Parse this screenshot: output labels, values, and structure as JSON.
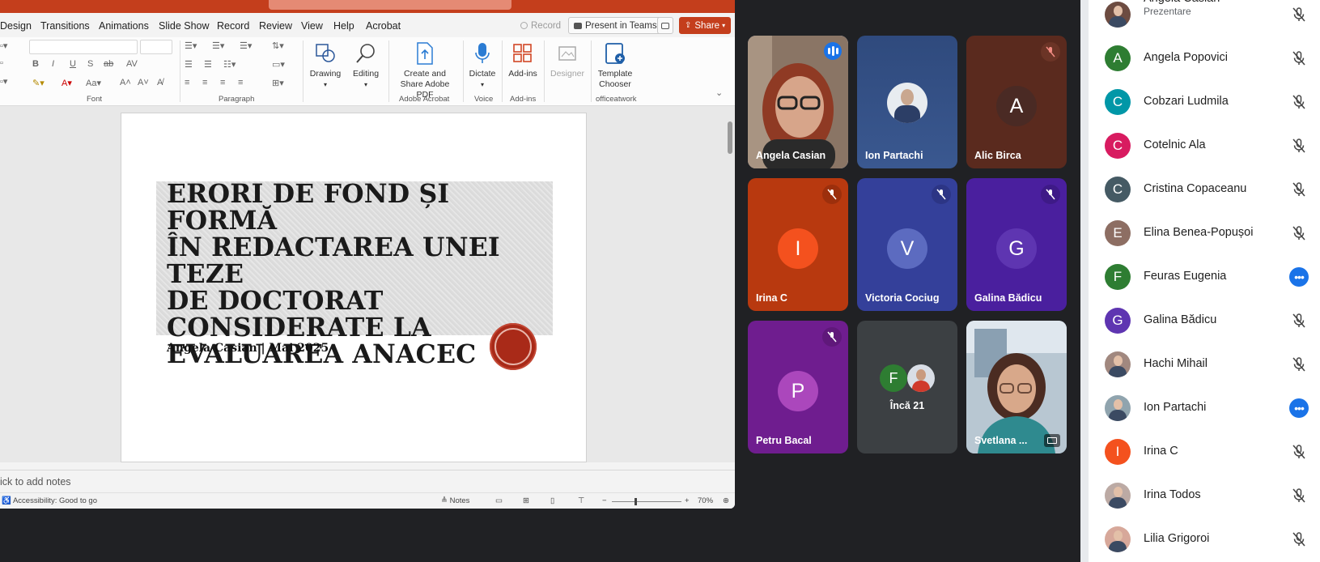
{
  "ppt": {
    "menu_tabs": [
      "Design",
      "Transitions",
      "Animations",
      "Slide Show",
      "Record",
      "Review",
      "View",
      "Help",
      "Acrobat"
    ],
    "record_label": "Record",
    "present_teams_label": "Present in Teams",
    "share_label": "Share",
    "ribbon": {
      "font_group": "Font",
      "paragraph_group": "Paragraph",
      "drawing": "Drawing",
      "editing": "Editing",
      "create_share": "Create and Share Adobe PDF",
      "adobe_group": "Adobe Acrobat",
      "dictate": "Dictate",
      "voice_group": "Voice",
      "addins": "Add-ins",
      "addins_group": "Add-ins",
      "designer": "Designer",
      "template_chooser": "Template Chooser",
      "officeatwork_group": "officeatwork"
    },
    "slide": {
      "title_lines": [
        "ERORI DE FOND ȘI FORMĂ",
        "ÎN REDACTAREA UNEI TEZE",
        "DE DOCTORAT",
        "CONSIDERATE LA",
        "EVALUAREA ANACEC"
      ],
      "subtitle": "Angela Casian | Mai 2025"
    },
    "notes_placeholder": "ick to add notes",
    "status": {
      "accessibility": "Accessibility: Good to go",
      "notes_btn": "Notes",
      "zoom": "70%"
    }
  },
  "meet": {
    "tiles": [
      {
        "name": "Angela Casian",
        "type": "video",
        "speaking": true,
        "muted": false
      },
      {
        "name": "Ion Partachi",
        "type": "photo",
        "muted": false
      },
      {
        "name": "Alic Birca",
        "letter": "A",
        "bg": "#5a2a1e",
        "avatar": "#4a2a24",
        "muted": true
      },
      {
        "name": "Irina C",
        "letter": "I",
        "bg": "#b8390f",
        "avatar": "#f4511e",
        "muted": true
      },
      {
        "name": "Victoria Cociug",
        "letter": "V",
        "bg": "#34409a",
        "avatar": "#5c6bc0",
        "muted": true
      },
      {
        "name": "Galina Bădicu",
        "letter": "G",
        "bg": "#4a1f9e",
        "avatar": "#5e35b1",
        "muted": true
      },
      {
        "name": "Petru Bacal",
        "letter": "P",
        "bg": "#6f1d8f",
        "avatar": "#ab47bc",
        "muted": true
      },
      {
        "name": "Încă 21",
        "type": "more",
        "bg": "#3c4043",
        "letter": "F"
      },
      {
        "name": "Svetlana ...",
        "type": "video2"
      }
    ]
  },
  "people": [
    {
      "name": "Angela Casian",
      "sub": "Prezentare",
      "letter": "",
      "color": "#6d4c41",
      "state": "muted",
      "photo": true
    },
    {
      "name": "Angela Popovici",
      "letter": "A",
      "color": "#2e7d32",
      "state": "muted"
    },
    {
      "name": "Cobzari Ludmila",
      "letter": "C",
      "color": "#0097a7",
      "state": "muted"
    },
    {
      "name": "Cotelnic Ala",
      "letter": "C",
      "color": "#d81b60",
      "state": "muted"
    },
    {
      "name": "Cristina Copaceanu",
      "letter": "C",
      "color": "#455a64",
      "state": "muted"
    },
    {
      "name": "Elina Benea-Popușoi",
      "letter": "E",
      "color": "#8d6e63",
      "state": "muted"
    },
    {
      "name": "Feuras Eugenia",
      "letter": "F",
      "color": "#2e7d32",
      "state": "more"
    },
    {
      "name": "Galina Bădicu",
      "letter": "G",
      "color": "#5e35b1",
      "state": "muted"
    },
    {
      "name": "Hachi Mihail",
      "letter": "",
      "color": "#a1887f",
      "state": "muted",
      "photo": true
    },
    {
      "name": "Ion Partachi",
      "letter": "",
      "color": "#90a4ae",
      "state": "more",
      "photo": true
    },
    {
      "name": "Irina C",
      "letter": "I",
      "color": "#f4511e",
      "state": "muted"
    },
    {
      "name": "Irina Todos",
      "letter": "",
      "color": "#bcaaa4",
      "state": "muted",
      "photo": true
    },
    {
      "name": "Lilia Grigoroi",
      "letter": "",
      "color": "#d7a89a",
      "state": "muted",
      "photo": true
    }
  ]
}
